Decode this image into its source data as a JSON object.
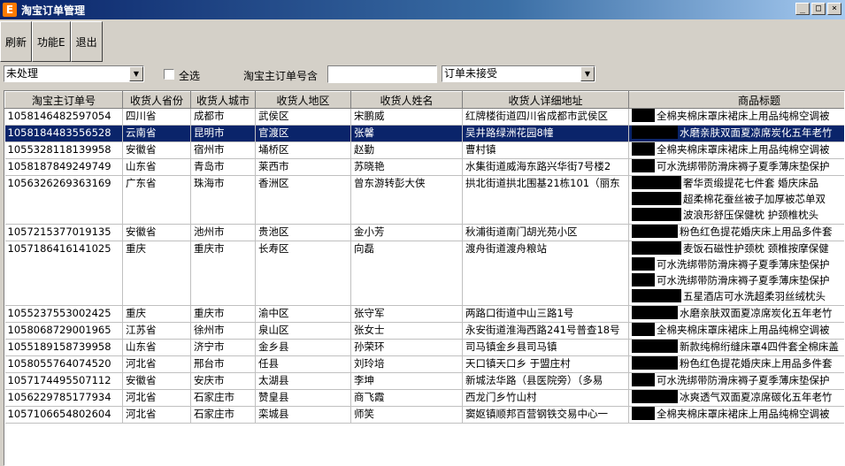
{
  "window": {
    "title": "淘宝订单管理",
    "controls": [
      "_",
      "□",
      "×"
    ]
  },
  "toolbar": {
    "refresh": "刷新",
    "features": "功能E",
    "exit": "退出"
  },
  "filters": {
    "status": "未处理",
    "select_all": "全选",
    "order_no_label": "淘宝主订单号含",
    "order_no_value": "",
    "accept_status": "订单未接受"
  },
  "table": {
    "columns": [
      "淘宝主订单号",
      "收货人省份",
      "收货人城市",
      "收货人地区",
      "收货人姓名",
      "收货人详细地址",
      "商品标题"
    ],
    "rows": [
      {
        "id": "1058146482597054",
        "province": "四川省",
        "city": "成都市",
        "district": "武侯区",
        "name": "宋鹏威",
        "address": "红牌楼街道四川省成都市武侯区",
        "title": [
          "全棉夹棉床罩床裙床上用品纯棉空调被"
        ],
        "redact": [
          26
        ]
      },
      {
        "id": "1058184483556528",
        "province": "云南省",
        "city": "昆明市",
        "district": "官渡区",
        "name": "张馨",
        "address": "吴井路绿洲花园8幢",
        "title": [
          "水磨亲肤双面夏凉席炭化五年老竹"
        ],
        "redact": [
          52
        ],
        "selected": true
      },
      {
        "id": "1055328118139958",
        "province": "安徽省",
        "city": "宿州市",
        "district": "埇桥区",
        "name": "赵勤",
        "address": "曹村镇",
        "title": [
          "全棉夹棉床罩床裙床上用品纯棉空调被"
        ],
        "redact": [
          26
        ]
      },
      {
        "id": "1058187849249749",
        "province": "山东省",
        "city": "青岛市",
        "district": "莱西市",
        "name": "苏晓艳",
        "address": "水集街道威海东路兴华街7号楼2",
        "title": [
          "可水洗绑带防滑床褥子夏季薄床垫保护"
        ],
        "redact": [
          26
        ]
      },
      {
        "id": "1056326269363169",
        "province": "广东省",
        "city": "珠海市",
        "district": "香洲区",
        "name": "曾东游转彭大侠",
        "address": "拱北街道拱北围基21栋101（丽东",
        "title": [
          "奢华贡缎提花七件套 婚庆床品",
          "超柔棉花蚕丝被子加厚被芯单双",
          "波浪形舒压保健枕 护颈椎枕头"
        ],
        "redact": [
          56,
          56,
          56
        ]
      },
      {
        "id": "1057215377019135",
        "province": "安徽省",
        "city": "池州市",
        "district": "贵池区",
        "name": "金小芳",
        "address": "秋浦街道南门胡光苑小区",
        "title": [
          "粉色红色提花婚庆床上用品多件套"
        ],
        "redact": [
          52
        ]
      },
      {
        "id": "1057186416141025",
        "province": "重庆",
        "city": "重庆市",
        "district": "长寿区",
        "name": "向磊",
        "address": "渡舟街道渡舟粮站",
        "title": [
          "麦饭石磁性护颈枕 颈椎按摩保健",
          "可水洗绑带防滑床褥子夏季薄床垫保护",
          "可水洗绑带防滑床褥子夏季薄床垫保护",
          "五星酒店可水洗超柔羽丝绒枕头"
        ],
        "redact": [
          56,
          26,
          26,
          56
        ]
      },
      {
        "id": "1055237553002425",
        "province": "重庆",
        "city": "重庆市",
        "district": "渝中区",
        "name": "张守军",
        "address": "两路口街道中山三路1号",
        "title": [
          "水磨亲肤双面夏凉席炭化五年老竹"
        ],
        "redact": [
          52
        ]
      },
      {
        "id": "1058068729001965",
        "province": "江苏省",
        "city": "徐州市",
        "district": "泉山区",
        "name": "张女士",
        "address": "永安街道淮海西路241号普查18号",
        "title": [
          "全棉夹棉床罩床裙床上用品纯棉空调被"
        ],
        "redact": [
          26
        ]
      },
      {
        "id": "1055189158739958",
        "province": "山东省",
        "city": "济宁市",
        "district": "金乡县",
        "name": "孙荣环",
        "address": "司马镇金乡县司马镇",
        "title": [
          "新款纯棉绗缝床罩4四件套全棉床盖"
        ],
        "redact": [
          52
        ]
      },
      {
        "id": "1058055764074520",
        "province": "河北省",
        "city": "邢台市",
        "district": "任县",
        "name": "刘玲培",
        "address": "天口镇天口乡 于盟庄村",
        "title": [
          "粉色红色提花婚庆床上用品多件套"
        ],
        "redact": [
          52
        ]
      },
      {
        "id": "1057174495507112",
        "province": "安徽省",
        "city": "安庆市",
        "district": "太湖县",
        "name": "李坤",
        "address": "新城法华路（县医院旁）（多易",
        "title": [
          "可水洗绑带防滑床褥子夏季薄床垫保护"
        ],
        "redact": [
          26
        ]
      },
      {
        "id": "1056229785177934",
        "province": "河北省",
        "city": "石家庄市",
        "district": "赞皇县",
        "name": "商飞霞",
        "address": "西龙门乡竹山村",
        "title": [
          "冰爽透气双面夏凉席碳化五年老竹"
        ],
        "redact": [
          52
        ]
      },
      {
        "id": "1057106654802604",
        "province": "河北省",
        "city": "石家庄市",
        "district": "栾城县",
        "name": "师笑",
        "address": "窦妪镇顺邦百营钢铁交易中心一",
        "title": [
          "全棉夹棉床罩床裙床上用品纯棉空调被"
        ],
        "redact": [
          26
        ]
      }
    ]
  }
}
